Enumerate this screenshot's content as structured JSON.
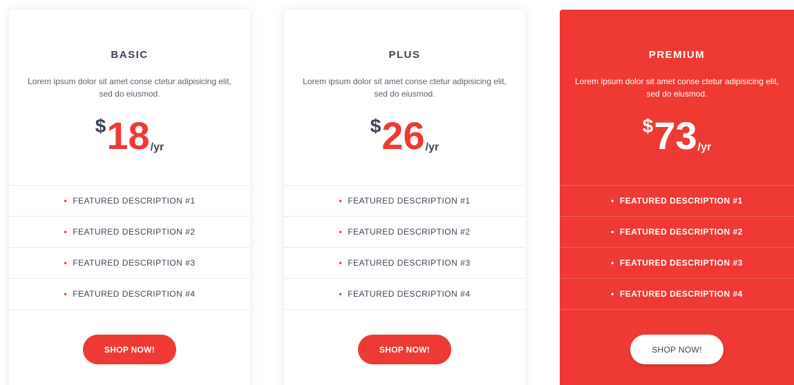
{
  "theme": {
    "accent": "#ee3a33",
    "text": "#3c4254"
  },
  "plans": [
    {
      "name": "BASIC",
      "description": "Lorem ipsum dolor sit amet conse ctetur adipisicing elit, sed do eiusmod.",
      "currency": "$",
      "amount": "18",
      "period": "/yr",
      "features": [
        "FEATURED DESCRIPTION #1",
        "FEATURED DESCRIPTION #2",
        "FEATURED DESCRIPTION #3",
        "FEATURED DESCRIPTION #4"
      ],
      "cta": "SHOP NOW!"
    },
    {
      "name": "PLUS",
      "description": "Lorem ipsum dolor sit amet conse ctetur adipisicing elit, sed do eiusmod.",
      "currency": "$",
      "amount": "26",
      "period": "/yr",
      "features": [
        "FEATURED DESCRIPTION #1",
        "FEATURED DESCRIPTION #2",
        "FEATURED DESCRIPTION #3",
        "FEATURED DESCRIPTION #4"
      ],
      "cta": "SHOP NOW!"
    },
    {
      "name": "PREMIUM",
      "description": "Lorem ipsum dolor sit amet conse ctetur adipisicing elit, sed do eiusmod.",
      "currency": "$",
      "amount": "73",
      "period": "/yr",
      "features": [
        "FEATURED DESCRIPTION #1",
        "FEATURED DESCRIPTION #2",
        "FEATURED DESCRIPTION #3",
        "FEATURED DESCRIPTION #4"
      ],
      "cta": "SHOP NOW!"
    }
  ]
}
